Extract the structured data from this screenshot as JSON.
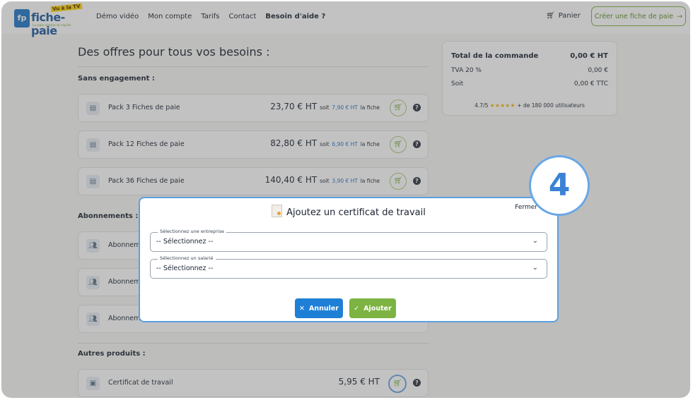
{
  "header": {
    "logo_text": "fiche-paie",
    "logo_badge": "Vu à la TV",
    "logo_tagline": "La paie simple et rapide",
    "nav": [
      "Démo vidéo",
      "Mon compte",
      "Tarifs",
      "Contact",
      "Besoin d'aide ?"
    ],
    "cart_label": "Panier",
    "cta_label": "Créer une fiche de paie"
  },
  "main": {
    "title": "Des offres pour tous vos besoins :",
    "sections": {
      "sans_engagement": "Sans engagement :",
      "abonnements": "Abonnements :",
      "autres": "Autres produits :"
    },
    "packs": [
      {
        "label": "Pack 3 Fiches de paie",
        "price": "23,70 € HT",
        "soit": "soit",
        "unit_price": "7,90 € HT",
        "suffix": "la fiche"
      },
      {
        "label": "Pack 12 Fiches de paie",
        "price": "82,80 € HT",
        "soit": "soit",
        "unit_price": "6,90 € HT",
        "suffix": "la fiche"
      },
      {
        "label": "Pack 36 Fiches de paie",
        "price": "140,40 € HT",
        "soit": "soit",
        "unit_price": "3,90 € HT",
        "suffix": "la fiche"
      }
    ],
    "subscriptions": [
      "Abonnem",
      "Abonnem",
      "Abonnem"
    ],
    "other": {
      "label": "Certificat de travail",
      "price": "5,95 € HT"
    }
  },
  "summary": {
    "total_label": "Total de la commande",
    "total_value": "0,00 € HT",
    "tva_label": "TVA 20 %",
    "tva_value": "0,00 €",
    "soit_label": "Soit",
    "soit_value": "0,00 € TTC",
    "rating": "4.7/5",
    "stars": "★★★★★",
    "users": "+ de 180 000 utilisateurs"
  },
  "modal": {
    "title": "Ajoutez un certificat de travail",
    "close": "Fermer",
    "company_legend": "Sélectionnez une entreprise",
    "company_value": "-- Sélectionnez --",
    "employee_legend": "Sélectionnez un salarié",
    "employee_value": "-- Sélectionnez --",
    "cancel": "Annuler",
    "add": "Ajouter"
  },
  "step_badge": "4",
  "colors": {
    "accent_green": "#7cb342",
    "accent_blue": "#1e7fd6",
    "highlight": "#6aa7e6"
  }
}
